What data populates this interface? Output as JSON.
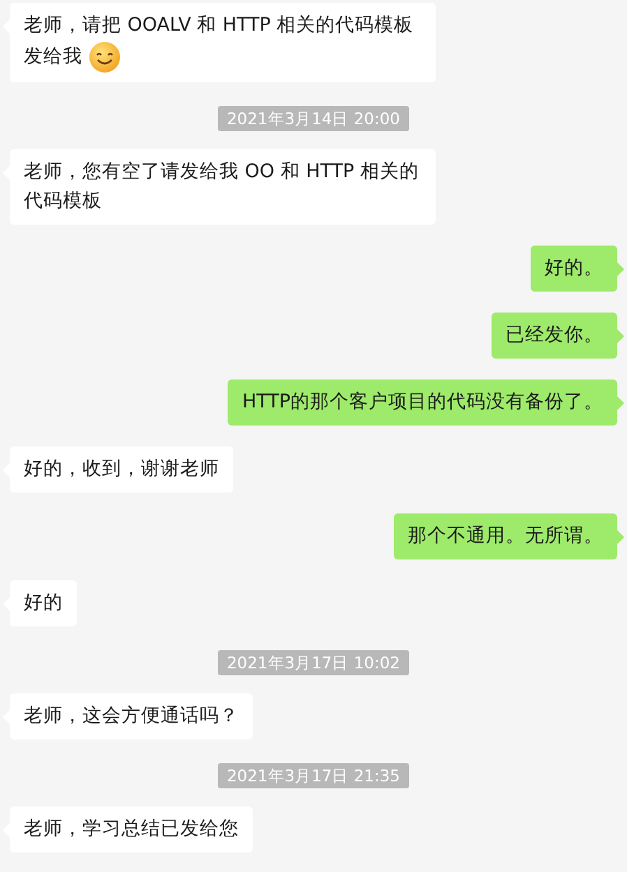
{
  "messages": [
    {
      "kind": "incoming",
      "text": "老师，请把 OOALV 和 HTTP 相关的代码模板发给我",
      "emoji": true
    },
    {
      "kind": "time",
      "text": "2021年3月14日 20:00"
    },
    {
      "kind": "incoming",
      "text": "老师，您有空了请发给我 OO 和 HTTP 相关的代码模板"
    },
    {
      "kind": "outgoing",
      "text": "好的。"
    },
    {
      "kind": "outgoing",
      "text": "已经发你。"
    },
    {
      "kind": "outgoing",
      "text": "HTTP的那个客户项目的代码没有备份了。"
    },
    {
      "kind": "incoming",
      "text": "好的，收到，谢谢老师"
    },
    {
      "kind": "outgoing",
      "text": "那个不通用。无所谓。"
    },
    {
      "kind": "incoming",
      "text": "好的"
    },
    {
      "kind": "time",
      "text": "2021年3月17日 10:02"
    },
    {
      "kind": "incoming",
      "text": "老师，这会方便通话吗？"
    },
    {
      "kind": "time",
      "text": "2021年3月17日 21:35"
    },
    {
      "kind": "incoming",
      "text": "老师，学习总结已发给您"
    }
  ]
}
